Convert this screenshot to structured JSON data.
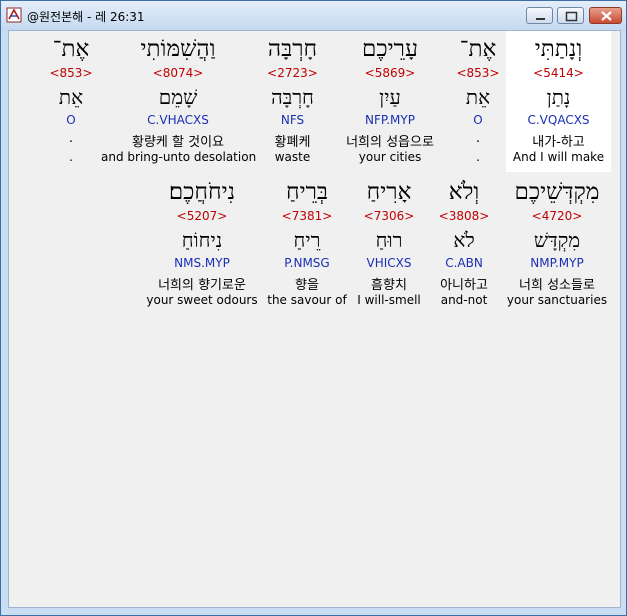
{
  "window": {
    "title": "@원전본해 - 레 26:31"
  },
  "rows": [
    [
      {
        "hebrew": "וְנָתַתִּי",
        "strong": "<5414>",
        "lexeme": "נָתַן",
        "parsing": "C.VQACXS",
        "korean": "내가-하고",
        "english": "And I will make",
        "selected": true
      },
      {
        "hebrew": "אֶת־",
        "strong": "<853>",
        "lexeme": "אֵת",
        "parsing": "O",
        "korean": ".",
        "english": "."
      },
      {
        "hebrew": "עָרֵיכֶם",
        "strong": "<5869>",
        "lexeme": "עַיִן",
        "parsing": "NFP.MYP",
        "korean": "너희의 성읍으로",
        "english": "your cities"
      },
      {
        "hebrew": "חָרְבָּה",
        "strong": "<2723>",
        "lexeme": "חָרְבָּה",
        "parsing": "NFS",
        "korean": "황폐케",
        "english": "waste"
      },
      {
        "hebrew": "וַהֲשִׁמּוֹתִי",
        "strong": "<8074>",
        "lexeme": "שָׁמֵם",
        "parsing": "C.VHACXS",
        "korean": "황량케 할 것이요",
        "english": "and bring-unto desolation"
      },
      {
        "hebrew": "אֶת־",
        "strong": "<853>",
        "lexeme": "אֵת",
        "parsing": "O",
        "korean": ".",
        "english": "."
      }
    ],
    [
      {
        "hebrew": "מִקְדְּשֵׁיכֶם",
        "strong": "<4720>",
        "lexeme": "מִקְדָּשׁ",
        "parsing": "NMP.MYP",
        "korean": "너희 성소들로",
        "english": "your sanctuaries"
      },
      {
        "hebrew": "וְלֹא",
        "strong": "<3808>",
        "lexeme": "לֹא",
        "parsing": "C.ABN",
        "korean": "아니하고",
        "english": "and-not"
      },
      {
        "hebrew": "אָרִיחַ",
        "strong": "<7306>",
        "lexeme": "רוּחַ",
        "parsing": "VHICXS",
        "korean": "흠향치",
        "english": "I will-smell"
      },
      {
        "hebrew": "בְּרֵיחַ",
        "strong": "<7381>",
        "lexeme": "רֵיחַ",
        "parsing": "P.NMSG",
        "korean": "향을",
        "english": "the savour of"
      },
      {
        "hebrew": "נִיחֹחֲכֶם׃",
        "strong": "<5207>",
        "lexeme": "נִיחוֹחַ",
        "parsing": "NMS.MYP",
        "korean": "너희의 향기로운",
        "english": "your sweet odours"
      }
    ]
  ]
}
